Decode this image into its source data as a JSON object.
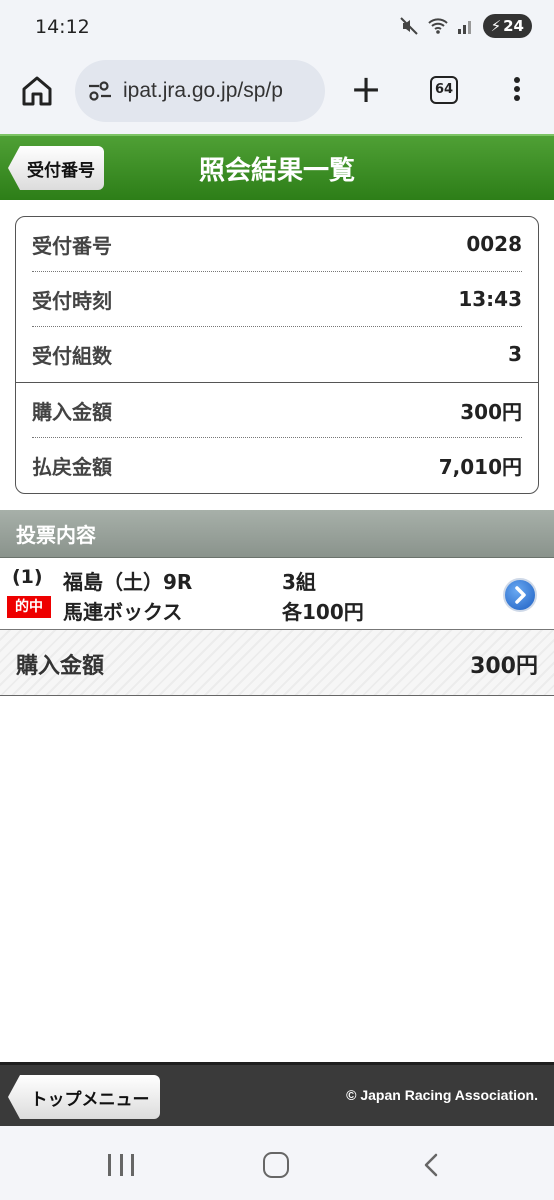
{
  "status_bar": {
    "time": "14:12",
    "battery": "24"
  },
  "browser": {
    "url": "ipat.jra.go.jp/sp/p",
    "tab_count": "64"
  },
  "header": {
    "back_label": "受付番号",
    "title": "照会結果一覧"
  },
  "info": {
    "rows": [
      {
        "label": "受付番号",
        "value": "0028"
      },
      {
        "label": "受付時刻",
        "value": "13:43"
      },
      {
        "label": "受付組数",
        "value": "3"
      },
      {
        "label": "購入金額",
        "value": "300円"
      },
      {
        "label": "払戻金額",
        "value": "7,010円"
      }
    ]
  },
  "section": {
    "title": "投票内容"
  },
  "vote": {
    "number": "(1)",
    "race": "福島（土）9R",
    "count": "3組",
    "badge": "的中",
    "bet_type": "馬連ボックス",
    "amount": "各100円"
  },
  "total": {
    "label": "購入金額",
    "value": "300円"
  },
  "footer": {
    "top_menu_label": "トップメニュー",
    "copyright": "© Japan Racing Association."
  },
  "colors": {
    "header_green": "#2d7e18",
    "hit_red": "#e00000",
    "section_gray": "#8a938c"
  }
}
